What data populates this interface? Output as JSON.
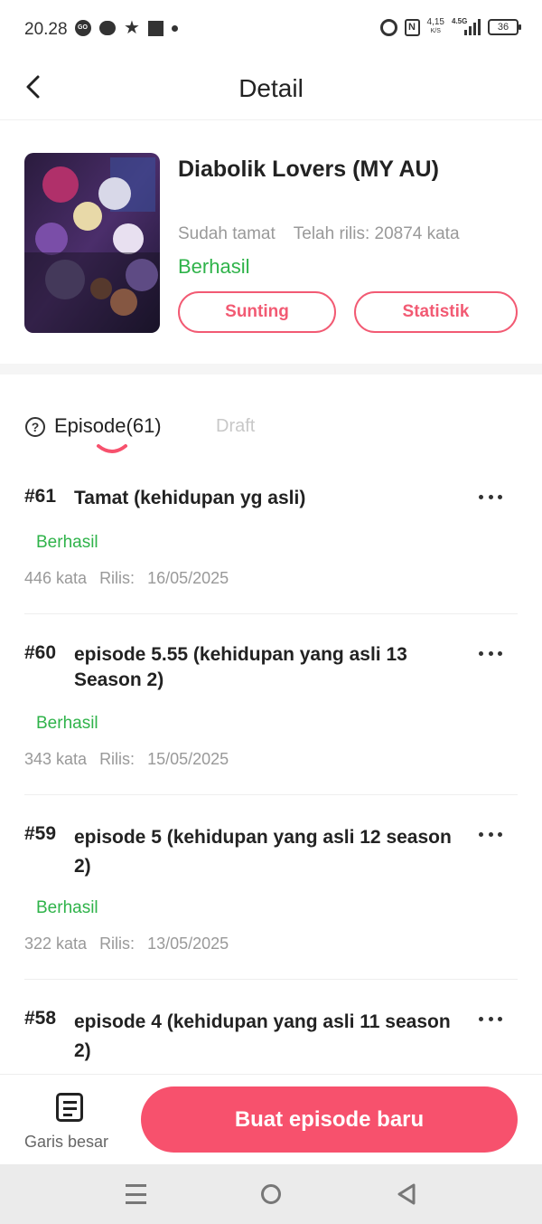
{
  "status_bar": {
    "time": "20.28",
    "left_icons": [
      "gojek-icon",
      "chat-icon",
      "star-icon",
      "square-icon",
      "dot-icon"
    ],
    "net_speed": "4,15",
    "net_speed_unit": "K/S",
    "network": "4.5G",
    "battery": "36"
  },
  "header": {
    "title": "Detail",
    "back_icon": "chevron-left-icon"
  },
  "book": {
    "title": "Diabolik Lovers (MY AU)",
    "completion": "Sudah tamat",
    "released": "Telah rilis: 20874 kata",
    "status": "Berhasil",
    "edit_label": "Sunting",
    "stats_label": "Statistik"
  },
  "tabs": {
    "episode_label": "Episode(61)",
    "draft_label": "Draft",
    "active": "Episode(61)"
  },
  "episodes": [
    {
      "number": "#61",
      "title": "Tamat (kehidupan yg asli)",
      "status": "Berhasil",
      "words": "446 kata",
      "release_label": "Rilis:",
      "date": "16/05/2025"
    },
    {
      "number": "#60",
      "title": "episode 5.55 (kehidupan yang asli 13 Season 2)",
      "status": "Berhasil",
      "words": "343 kata",
      "release_label": "Rilis:",
      "date": "15/05/2025"
    },
    {
      "number": "#59",
      "title": "episode 5 (kehidupan yang asli 12 season 2)",
      "status": "Berhasil",
      "words": "322 kata",
      "release_label": "Rilis:",
      "date": "13/05/2025"
    },
    {
      "number": "#58",
      "title": "episode 4 (kehidupan yang asli 11 season 2)"
    }
  ],
  "bottom_bar": {
    "outline_label": "Garis besar",
    "new_episode_label": "Buat episode baru"
  },
  "colors": {
    "accent": "#f7516d",
    "success": "#2fb34a",
    "muted": "#999999"
  }
}
